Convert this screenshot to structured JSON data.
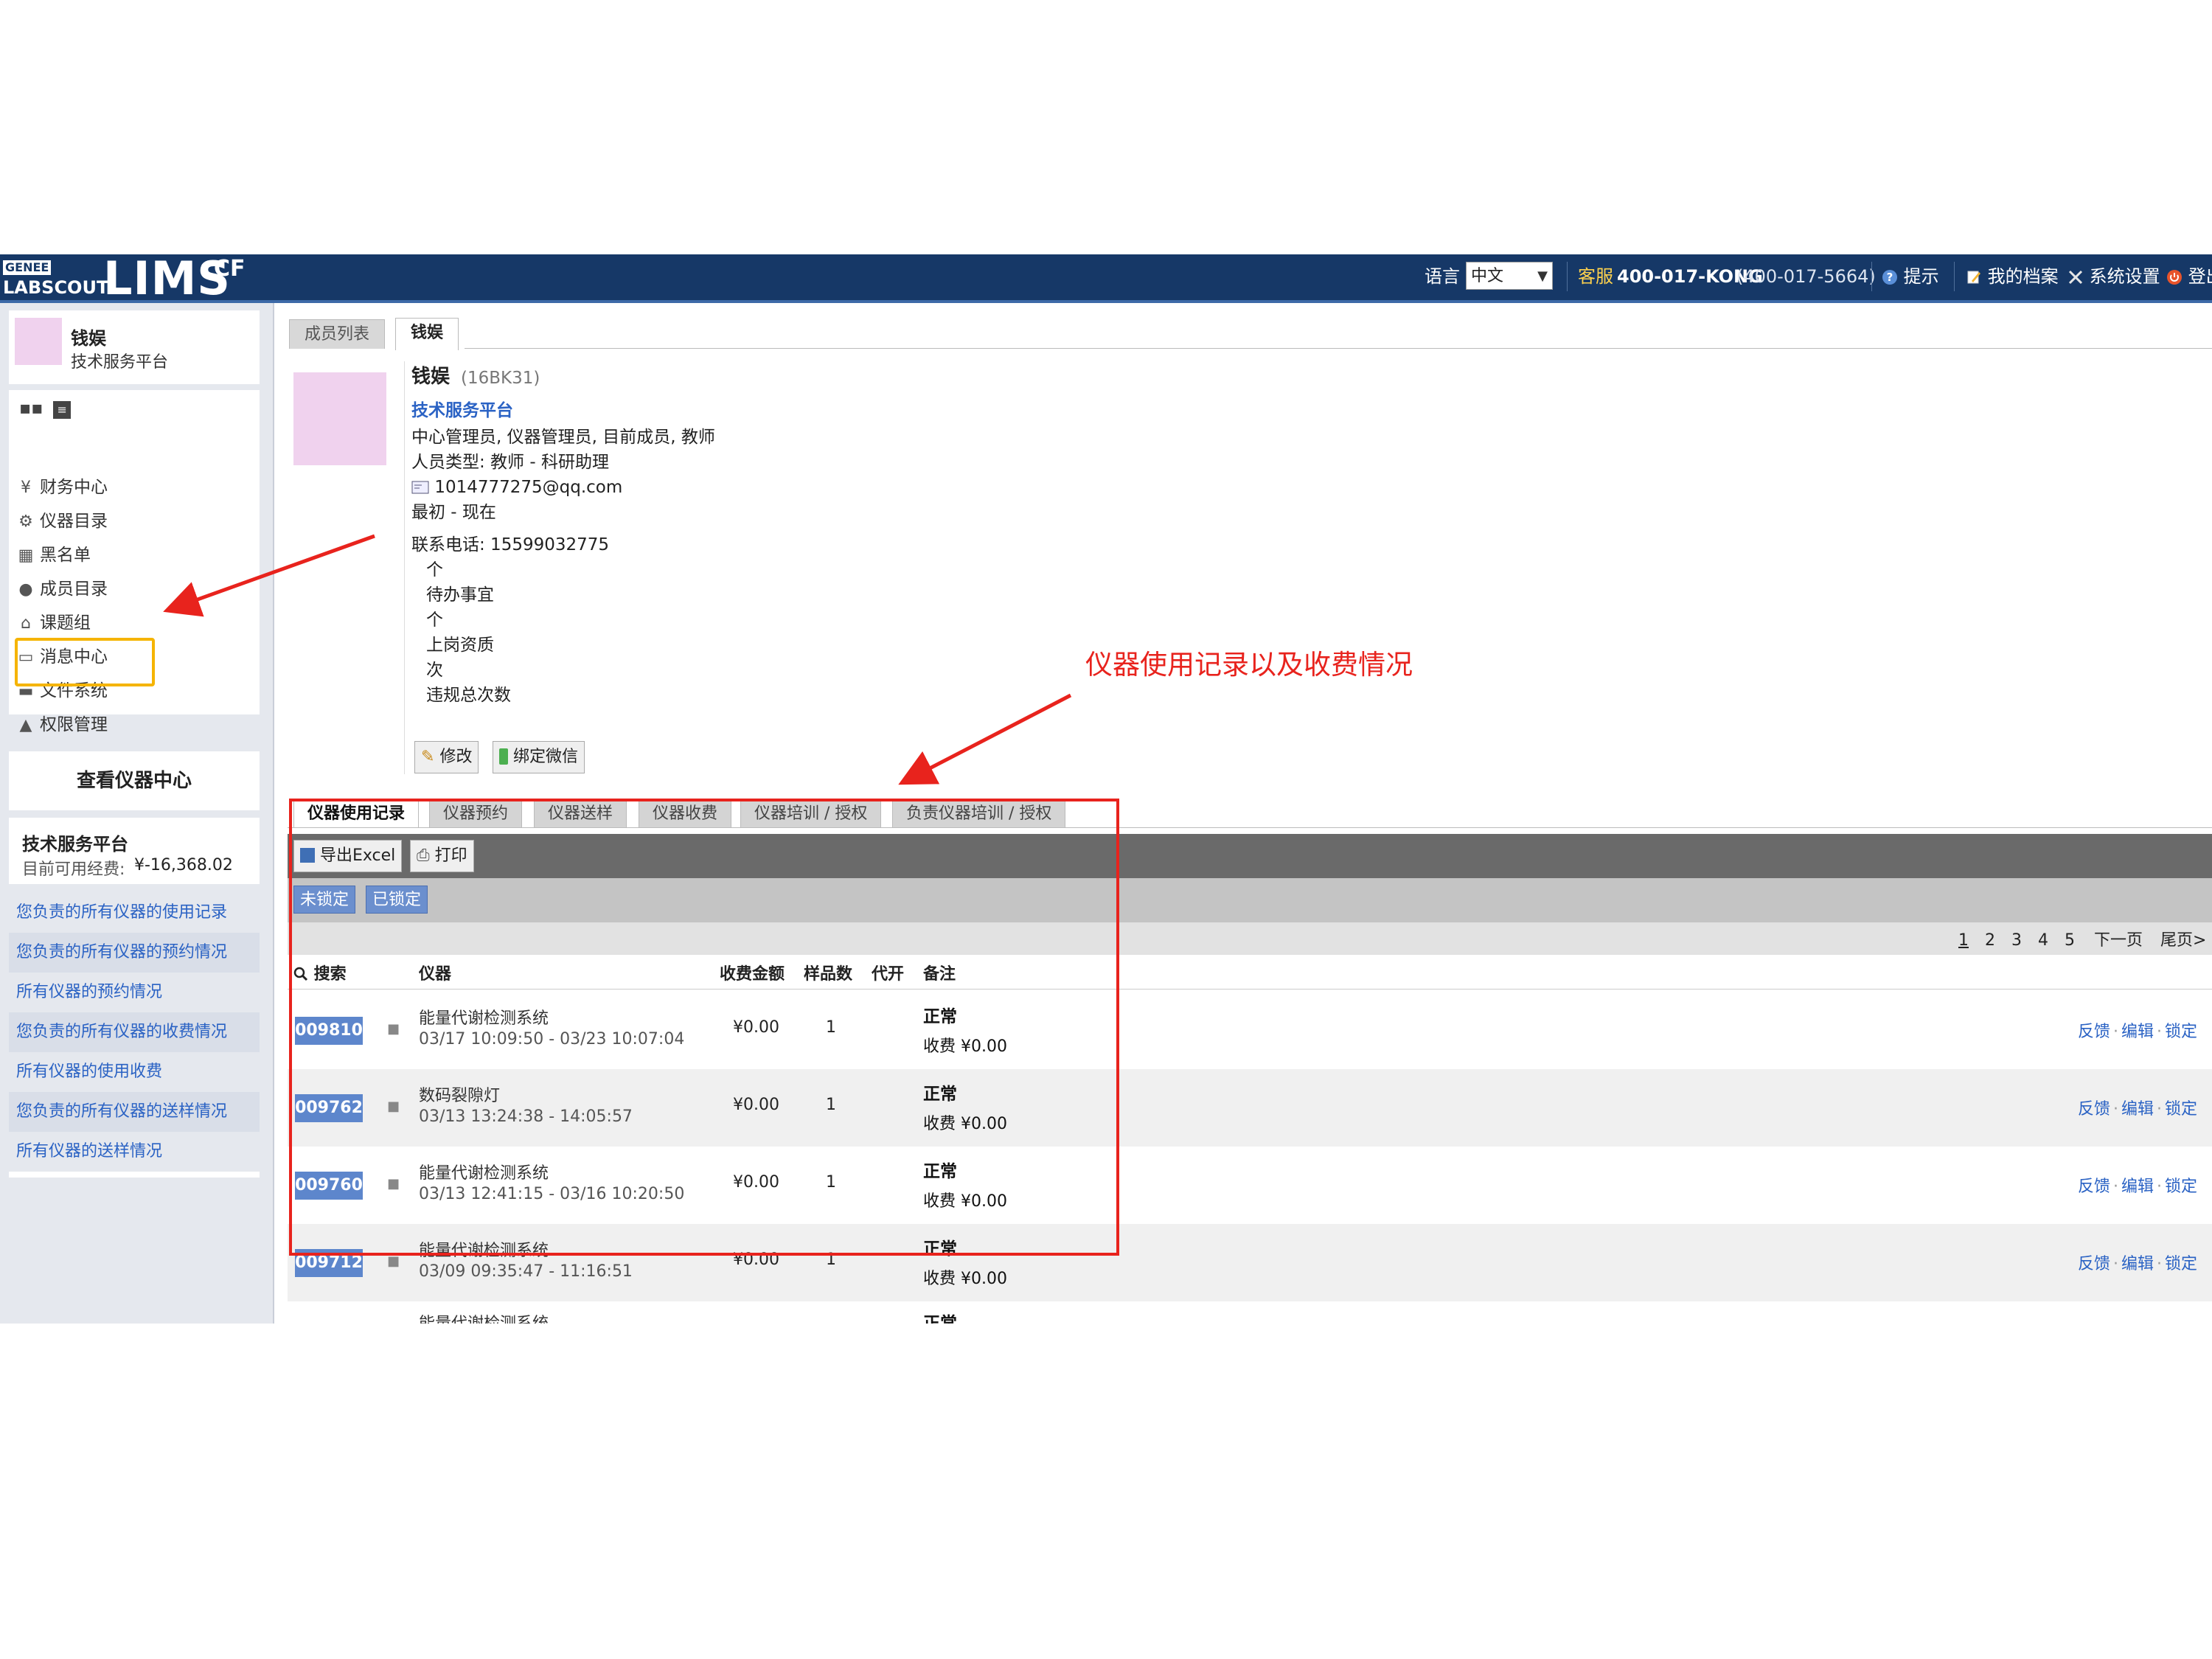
{
  "topbar": {
    "logo_genee": "GENEE",
    "logo_labscout": "LABSCOUT",
    "logo_lims": "LIMS",
    "logo_cf": "CF",
    "lang_label": "语言",
    "lang_value": "中文",
    "service_prefix": "客服",
    "service_phone": "400-017-KONG",
    "service_phone_num": "(400-017-5664)",
    "hint": "提示",
    "profile": "我的档案",
    "settings": "系统设置",
    "logout": "登出"
  },
  "sidebar": {
    "user_name": "钱娱",
    "user_org": "技术服务平台",
    "menu": [
      {
        "label": "财务中心",
        "icon": "yen-icon"
      },
      {
        "label": "仪器目录",
        "icon": "gear-icon"
      },
      {
        "label": "黑名单",
        "icon": "calendar-icon"
      },
      {
        "label": "成员目录",
        "icon": "user-icon"
      },
      {
        "label": "课题组",
        "icon": "home-icon"
      },
      {
        "label": "消息中心",
        "icon": "message-icon"
      },
      {
        "label": "文件系统",
        "icon": "folder-icon"
      },
      {
        "label": "权限管理",
        "icon": "warning-icon"
      }
    ],
    "view_center": "查看仪器中心",
    "platform_name": "技术服务平台",
    "funds_label": "目前可用经费:",
    "funds_value": "¥-16,368.02",
    "links": [
      "您负责的所有仪器的使用记录",
      "您负责的所有仪器的预约情况",
      "所有仪器的预约情况",
      "您负责的所有仪器的收费情况",
      "所有仪器的使用收费",
      "您负责的所有仪器的送样情况",
      "所有仪器的送样情况"
    ]
  },
  "tabs": {
    "members": "成员列表",
    "current": "钱娱"
  },
  "profile": {
    "name": "钱娱",
    "code": "(16BK31)",
    "org_link": "技术服务平台",
    "roles": "中心管理员, 仪器管理员, 目前成员, 教师",
    "type": "人员类型: 教师 - 科研助理",
    "email": "1014777275@qq.com",
    "period": "最初 - 现在",
    "phone": "联系电话: 15599032775",
    "stat1_unit": "个",
    "stat1_label": "待办事宜",
    "stat2_unit": "个",
    "stat2_label": "上岗资质",
    "stat3_unit": "次",
    "stat3_label": "违规总次数",
    "edit_button": "修改",
    "wechat_button": "绑定微信"
  },
  "subtabs": [
    "仪器使用记录",
    "仪器预约",
    "仪器送样",
    "仪器收费",
    "仪器培训 / 授权",
    "负责仪器培训 / 授权"
  ],
  "toolbar": {
    "export": "导出Excel",
    "print": "打印",
    "unlocked": "未锁定",
    "locked": "已锁定"
  },
  "pagination": {
    "pages": [
      "1",
      "2",
      "3",
      "4",
      "5"
    ],
    "next": "下一页",
    "last": "尾页>"
  },
  "table": {
    "headers": {
      "search": "搜索",
      "instrument": "仪器",
      "fee": "收费金额",
      "samples": "样品数",
      "proxy": "代开",
      "remark": "备注"
    },
    "rows": [
      {
        "id": "009810",
        "name": "能量代谢检测系统",
        "time": "03/17 10:09:50 - 03/23 10:07:04",
        "fee": "¥0.00",
        "count": "1",
        "status": "正常",
        "charge": "收费 ¥0.00"
      },
      {
        "id": "009762",
        "name": "数码裂隙灯",
        "time": "03/13 13:24:38 - 14:05:57",
        "fee": "¥0.00",
        "count": "1",
        "status": "正常",
        "charge": "收费 ¥0.00"
      },
      {
        "id": "009760",
        "name": "能量代谢检测系统",
        "time": "03/13 12:41:15 - 03/16 10:20:50",
        "fee": "¥0.00",
        "count": "1",
        "status": "正常",
        "charge": "收费 ¥0.00"
      },
      {
        "id": "009712",
        "name": "能量代谢检测系统",
        "time": "03/09 09:35:47 - 11:16:51",
        "fee": "¥0.00",
        "count": "1",
        "status": "正常",
        "charge": "收费 ¥0.00"
      }
    ],
    "partial_row": {
      "name": "能量代谢检测系统",
      "status": "正常"
    },
    "actions": {
      "feedback": "反馈",
      "edit": "编辑",
      "lock": "锁定"
    }
  },
  "annotation": {
    "label": "仪器使用记录以及收费情况",
    "color": "#e8231d",
    "highlight_color": "#f5b400"
  },
  "colors": {
    "topbar": "#163867",
    "link": "#2a62c4",
    "id_badge": "#5d86cc"
  }
}
